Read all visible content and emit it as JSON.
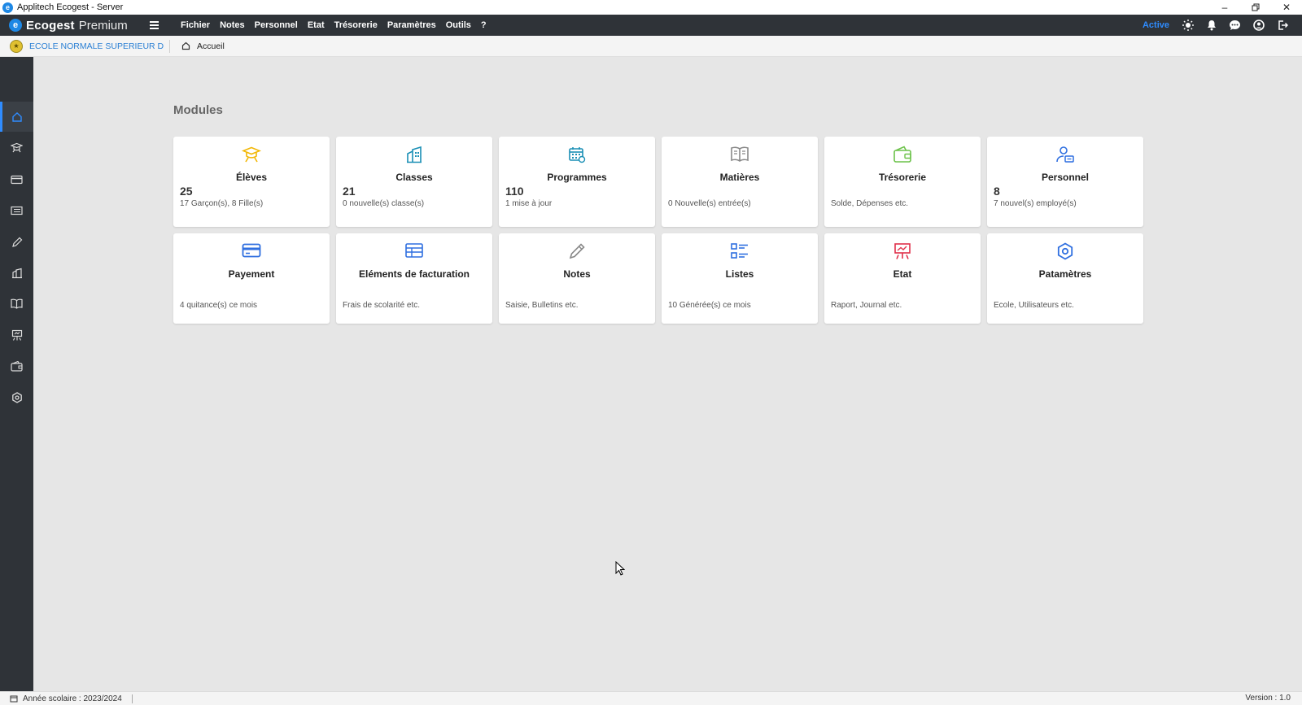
{
  "window": {
    "title": "Applitech Ecogest - Server",
    "controls": [
      "minimize",
      "restore",
      "close"
    ]
  },
  "topbar": {
    "brand_name": "Ecogest",
    "brand_edition": "Premium",
    "menu": [
      "Fichier",
      "Notes",
      "Personnel",
      "Etat",
      "Trésorerie",
      "Paramètres",
      "Outils",
      "?"
    ],
    "status": "Active",
    "icons": [
      "sun-icon",
      "bell-icon",
      "chat-icon",
      "user-icon",
      "logout-icon"
    ],
    "status_color": "#2f8cff"
  },
  "breadcrumb": {
    "school": "ECOLE NORMALE SUPERIEUR DE L...",
    "home": "Accueil"
  },
  "sidebar": {
    "items": [
      "home-icon",
      "graduation-cap-icon",
      "credit-card-icon",
      "billing-icon",
      "pencil-icon",
      "classes-icon",
      "book-icon",
      "presentation-icon",
      "wallet-icon",
      "settings-icon"
    ],
    "active_index": 0,
    "accent": "#2f8cff"
  },
  "main": {
    "section_title": "Modules",
    "modules": [
      {
        "icon": "graduation-cap-icon",
        "color": "#f2b705",
        "title": "Élèves",
        "value": "25",
        "subtitle": "17 Garçon(s), 8 Fille(s)"
      },
      {
        "icon": "building-icon",
        "color": "#1a8fb5",
        "title": "Classes",
        "value": "21",
        "subtitle": "0 nouvelle(s) classe(s)"
      },
      {
        "icon": "calendar-icon",
        "color": "#1a8fb5",
        "title": "Programmes",
        "value": "110",
        "subtitle": "1 mise à jour"
      },
      {
        "icon": "book-icon",
        "color": "#888888",
        "title": "Matières",
        "value": "",
        "subtitle": "0 Nouvelle(s) entrée(s)"
      },
      {
        "icon": "wallet-icon",
        "color": "#6cc24a",
        "title": "Trésorerie",
        "value": "",
        "subtitle": "Solde, Dépenses etc."
      },
      {
        "icon": "user-card-icon",
        "color": "#2f6fe0",
        "title": "Personnel",
        "value": "8",
        "subtitle": "7 nouvel(s) employé(s)"
      },
      {
        "icon": "credit-card-icon",
        "color": "#2f6fe0",
        "title": "Payement",
        "value": "",
        "subtitle": "4 quitance(s) ce mois"
      },
      {
        "icon": "billing-icon",
        "color": "#2f6fe0",
        "title": "Eléments de facturation",
        "value": "",
        "subtitle": "Frais de scolarité etc."
      },
      {
        "icon": "pencil-icon",
        "color": "#888888",
        "title": "Notes",
        "value": "",
        "subtitle": "Saisie, Bulletins etc."
      },
      {
        "icon": "list-icon",
        "color": "#2f6fe0",
        "title": "Listes",
        "value": "",
        "subtitle": "10 Générée(s) ce mois"
      },
      {
        "icon": "presentation-icon",
        "color": "#e0304a",
        "title": "Etat",
        "value": "",
        "subtitle": "Raport, Journal etc."
      },
      {
        "icon": "gear-icon",
        "color": "#2f6fe0",
        "title": "Patamètres",
        "value": "",
        "subtitle": "Ecole, Utilisateurs etc."
      }
    ]
  },
  "statusbar": {
    "school_year": "Année scolaire :  2023/2024",
    "version": "Version : 1.0"
  }
}
